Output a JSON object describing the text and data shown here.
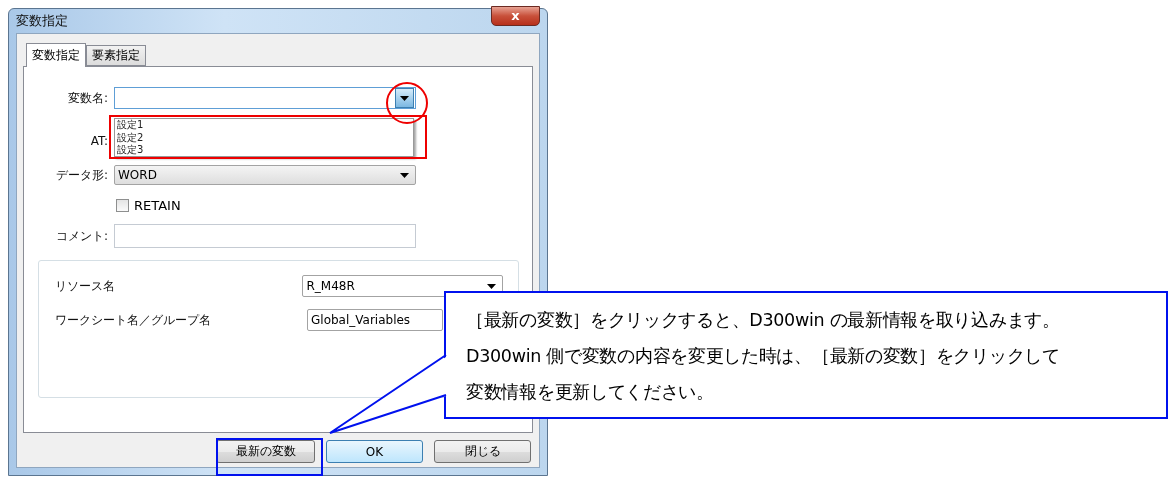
{
  "window": {
    "title": "変数指定",
    "close_label": "x"
  },
  "tabs": [
    {
      "label": "変数指定",
      "selected": true
    },
    {
      "label": "要素指定",
      "selected": false
    }
  ],
  "variable_name": {
    "label": "変数名:",
    "expanded": true,
    "options": [
      "設定1",
      "設定2",
      "設定3"
    ]
  },
  "at": {
    "label": "AT:"
  },
  "data_type": {
    "label": "データ形:",
    "value": "WORD"
  },
  "retain": {
    "label": "RETAIN",
    "checked": false
  },
  "comment": {
    "label": "コメント:"
  },
  "resource": {
    "label": "リソース名",
    "value": "R_M48R"
  },
  "worksheet": {
    "label": "ワークシート名／グループ名",
    "value": "Global_Variables"
  },
  "buttons": [
    {
      "label": "最新の変数",
      "kind": "normal"
    },
    {
      "label": "OK",
      "kind": "default"
    },
    {
      "label": "閉じる",
      "kind": "normal"
    }
  ],
  "callout": {
    "lines": [
      "［最新の変数］をクリックすると、D300win の最新情報を取り込みます。",
      "D300win 側で変数の内容を変更した時は、［最新の変数］をクリックして",
      "変数情報を更新してください。"
    ]
  }
}
